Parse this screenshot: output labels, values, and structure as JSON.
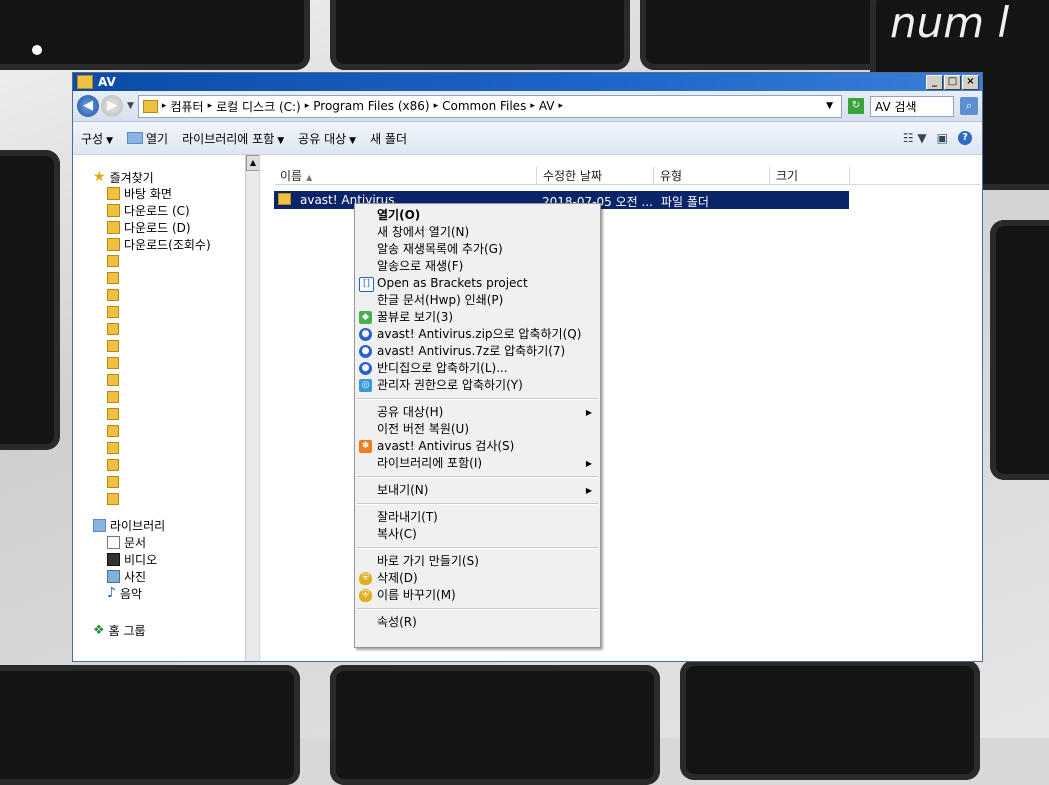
{
  "window": {
    "title": "AV"
  },
  "address": {
    "crumbs": [
      "컴퓨터",
      "로컬 디스크 (C:)",
      "Program Files (x86)",
      "Common Files",
      "AV"
    ],
    "search_placeholder": "AV 검색"
  },
  "background": {
    "key_label": "num l"
  },
  "toolbar": {
    "organize": "구성",
    "open": "열기",
    "include_library": "라이브러리에 포함",
    "share": "공유 대상",
    "new_folder": "새 폴더"
  },
  "nav": {
    "favorites": "즐겨찾기",
    "desktop": "바탕 화면",
    "download_c": "다운로드 (C)",
    "download_d": "다운로드 (D)",
    "download_views": "다운로드(조회수)",
    "libraries": "라이브러리",
    "documents": "문서",
    "videos": "비디오",
    "pictures": "사진",
    "music": "음악",
    "homegroup": "홈 그룹"
  },
  "columns": {
    "name": "이름",
    "modified": "수정한 날짜",
    "type": "유형",
    "size": "크기"
  },
  "file": {
    "name": "avast! Antivirus",
    "date": "2018-07-05 오전 ...",
    "type": "파일 폴더"
  },
  "menu": {
    "open": "열기(O)",
    "open_new": "새 창에서 열기(N)",
    "alsong_add": "알송 재생목록에 추가(G)",
    "alsong_play": "알송으로 재생(F)",
    "brackets": "Open as Brackets project",
    "hwp_print": "한글 문서(Hwp) 인쇄(P)",
    "honeyview": "꿀뷰로 보기(3)",
    "zip": "avast! Antivirus.zip으로 압축하기(Q)",
    "sevenz": "avast! Antivirus.7z로 압축하기(7)",
    "bandizip": "반디집으로 압축하기(L)...",
    "admin_zip": "관리자 권한으로 압축하기(Y)",
    "share": "공유 대상(H)",
    "restore": "이전 버전 복원(U)",
    "avast_scan": "avast! Antivirus 검사(S)",
    "include_lib": "라이브러리에 포함(I)",
    "send_to": "보내기(N)",
    "cut": "잘라내기(T)",
    "copy": "복사(C)",
    "shortcut": "바로 가기 만들기(S)",
    "delete": "삭제(D)",
    "rename": "이름 바꾸기(M)",
    "properties": "속성(R)"
  },
  "colors": {
    "selection": "#0a246a",
    "title_bar": "#1f66c9",
    "menu_bg": "#f0f0f0"
  }
}
